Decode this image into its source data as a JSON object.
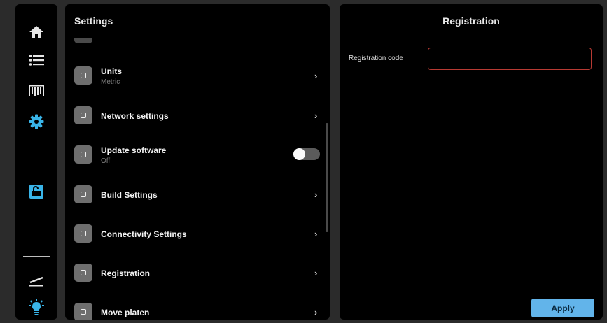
{
  "colors": {
    "accent": "#62b4ea",
    "active_icon": "#39b4e8",
    "input_border": "#b73a33",
    "panel_bg": "#000000",
    "screen_bg": "#2b2b2b"
  },
  "rail": {
    "items": [
      {
        "icon": "home-icon"
      },
      {
        "icon": "list-icon"
      },
      {
        "icon": "print-jobs-icon"
      },
      {
        "icon": "gear-icon",
        "active": true
      },
      {
        "icon": "unlock-icon",
        "active": true
      },
      {
        "icon": "level-icon"
      },
      {
        "icon": "lightbulb-icon"
      }
    ]
  },
  "settings": {
    "title": "Settings",
    "items": [
      {
        "title": "Units",
        "subtitle": "Metric",
        "control": "chevron"
      },
      {
        "title": "Network settings",
        "subtitle": "",
        "control": "chevron"
      },
      {
        "title": "Update software",
        "subtitle": "Off",
        "control": "toggle",
        "toggle_on": false
      },
      {
        "title": "Build Settings",
        "subtitle": "",
        "control": "chevron"
      },
      {
        "title": "Connectivity Settings",
        "subtitle": "",
        "control": "chevron"
      },
      {
        "title": "Registration",
        "subtitle": "",
        "control": "chevron"
      },
      {
        "title": "Move platen",
        "subtitle": "",
        "control": "chevron"
      }
    ],
    "chevron_glyph": "›"
  },
  "registration": {
    "title": "Registration",
    "code_label": "Registration code",
    "code_value": "",
    "apply_label": "Apply"
  }
}
